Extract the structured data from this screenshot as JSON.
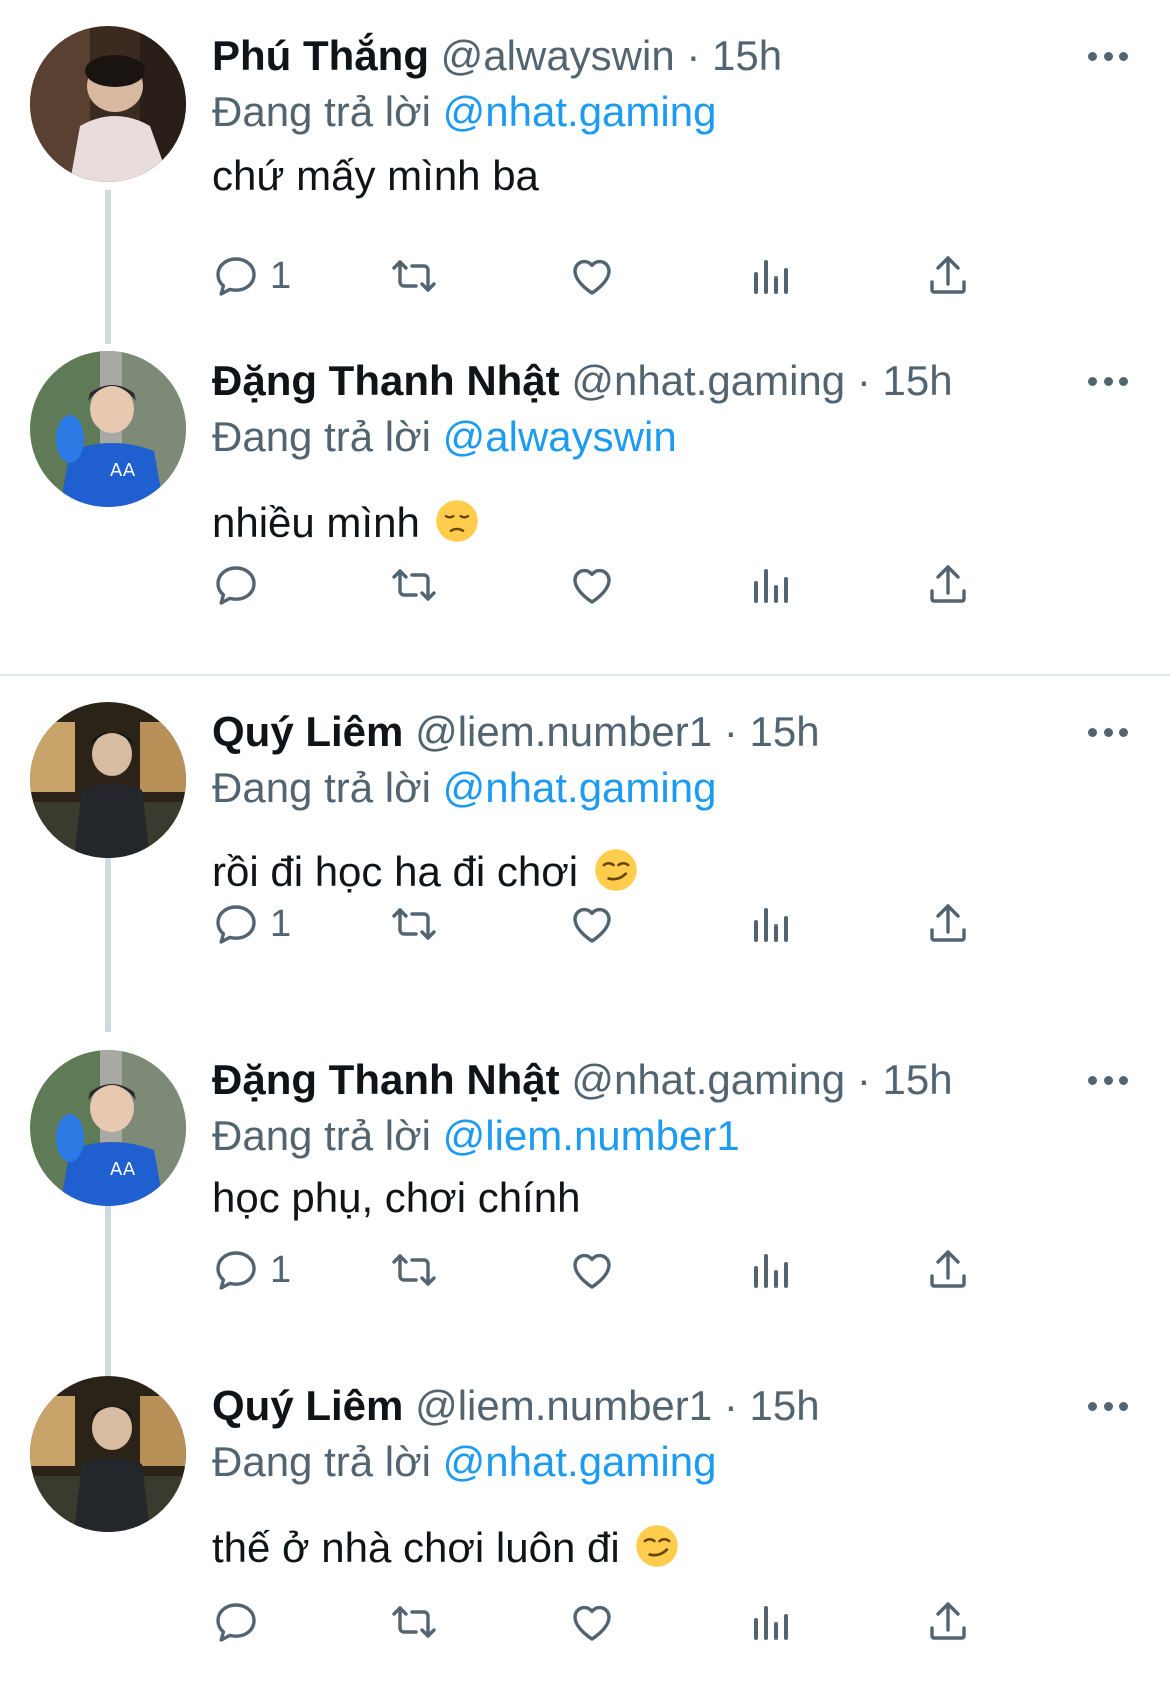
{
  "reply_prefix": "Đang trả lời",
  "tweets": [
    {
      "name": "Phú Thắng",
      "handle": "@alwayswin",
      "time": "15h",
      "reply_to": "@nhat.gaming",
      "text": "chứ mấy mình ba",
      "reply_count": "1",
      "emoji": ""
    },
    {
      "name": "Đặng Thanh Nhật",
      "handle": "@nhat.gaming",
      "time": "15h",
      "reply_to": "@alwayswin",
      "text": "nhiều mình",
      "reply_count": "",
      "emoji": "pensive-face"
    },
    {
      "name": "Quý Liêm",
      "handle": "@liem.number1",
      "time": "15h",
      "reply_to": "@nhat.gaming",
      "text": "rồi đi học ha đi chơi",
      "reply_count": "1",
      "emoji": "smirking-face"
    },
    {
      "name": "Đặng Thanh Nhật",
      "handle": "@nhat.gaming",
      "time": "15h",
      "reply_to": "@liem.number1",
      "text": "học phụ, chơi chính",
      "reply_count": "1",
      "emoji": ""
    },
    {
      "name": "Quý Liêm",
      "handle": "@liem.number1",
      "time": "15h",
      "reply_to": "@nhat.gaming",
      "text": "thế ở nhà chơi luôn đi",
      "reply_count": "",
      "emoji": "smirking-face"
    }
  ],
  "icons": {
    "reply": "reply-icon",
    "retweet": "retweet-icon",
    "like": "heart-icon",
    "views": "analytics-icon",
    "share": "share-icon",
    "more": "more-icon"
  },
  "colors": {
    "text": "#0f1419",
    "secondary": "#536471",
    "mention": "#1d9bf0",
    "thread_line": "#cfd9de",
    "divider": "#e1e8ed"
  }
}
